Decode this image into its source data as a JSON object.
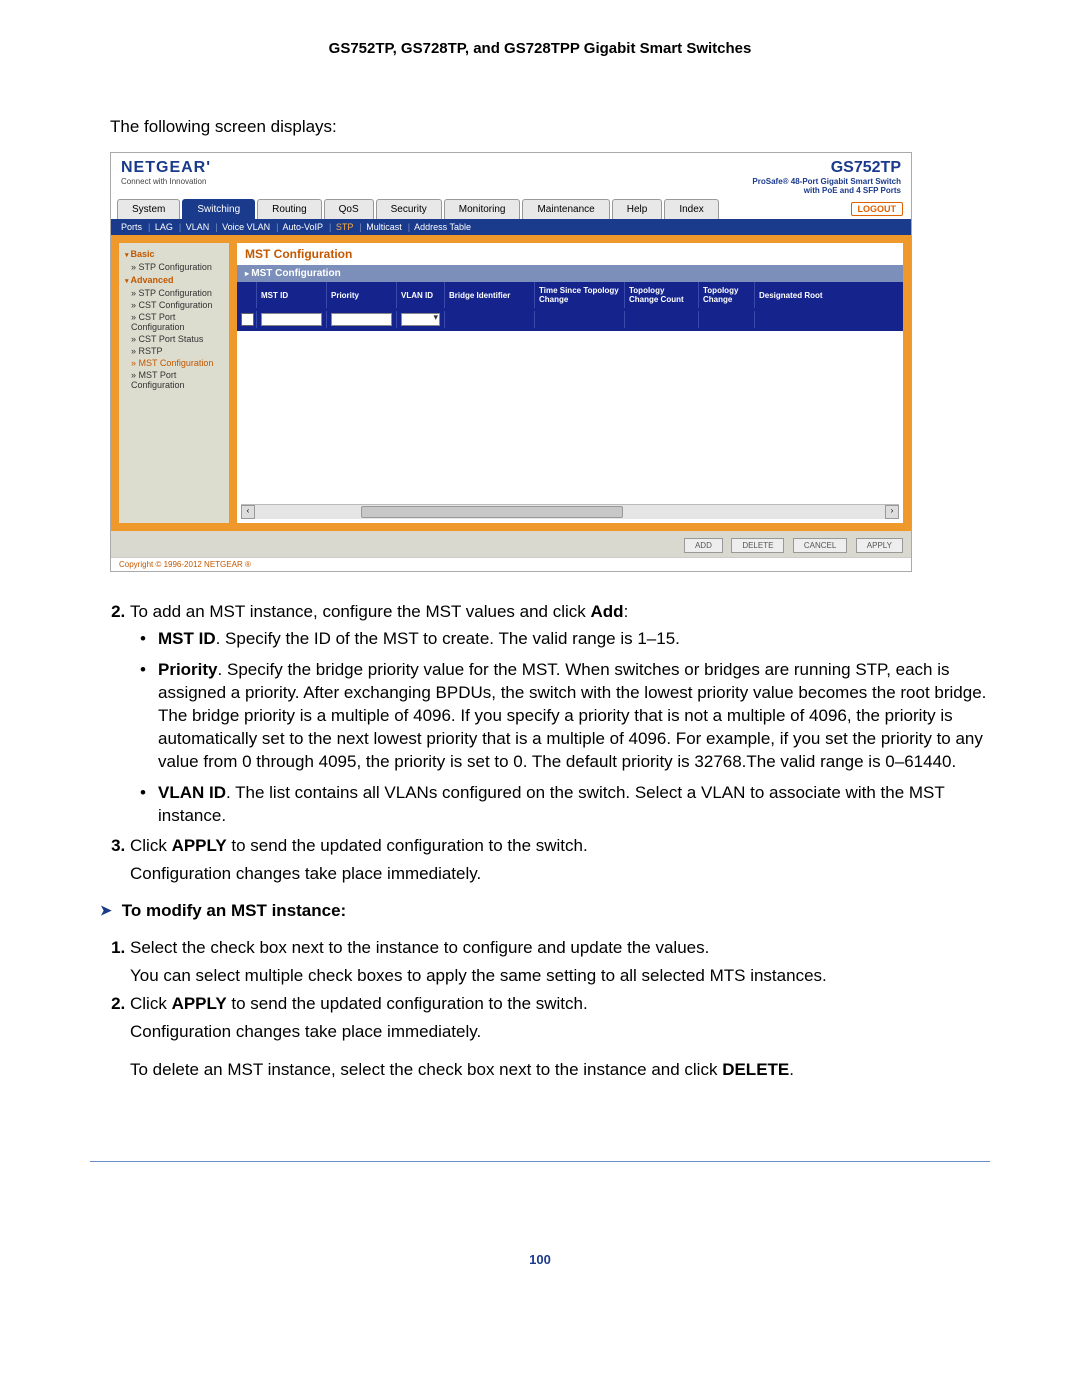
{
  "doc_header": "GS752TP, GS728TP, and GS728TPP Gigabit Smart Switches",
  "intro": "The following screen displays:",
  "screenshot": {
    "brand": "NETGEAR",
    "brand_sub": "Connect with Innovation",
    "model": "GS752TP",
    "model_sub1": "ProSafe® 48-Port Gigabit Smart Switch",
    "model_sub2": "with PoE and 4 SFP Ports",
    "logout": "LOGOUT",
    "main_tabs": [
      "System",
      "Switching",
      "Routing",
      "QoS",
      "Security",
      "Monitoring",
      "Maintenance",
      "Help",
      "Index"
    ],
    "active_main_tab": "Switching",
    "sub_tabs": [
      "Ports",
      "LAG",
      "VLAN",
      "Voice VLAN",
      "Auto-VoIP",
      "STP",
      "Multicast",
      "Address Table"
    ],
    "active_sub_tab": "STP",
    "sidebar": {
      "basic_head": "Basic",
      "basic_items": [
        "STP Configuration"
      ],
      "adv_head": "Advanced",
      "adv_items": [
        "STP Configuration",
        "CST Configuration",
        "CST Port Configuration",
        "CST Port Status",
        "RSTP",
        "MST Configuration",
        "MST Port Configuration"
      ],
      "adv_highlight": "MST Configuration"
    },
    "panel_title": "MST Configuration",
    "panel_bar": "MST Configuration",
    "columns": [
      "",
      "MST ID",
      "Priority",
      "VLAN ID",
      "Bridge Identifier",
      "Time Since Topology Change",
      "Topology Change Count",
      "Topology Change",
      "Designated Root"
    ],
    "action_buttons": [
      "ADD",
      "DELETE",
      "CANCEL",
      "APPLY"
    ],
    "copyright": "Copyright © 1996-2012 NETGEAR ®"
  },
  "step2": {
    "num": "2.",
    "text_a": "To add an MST instance, configure the MST values and click ",
    "text_b": "Add",
    "text_c": ":",
    "bullets": [
      {
        "b": "MST ID",
        "t": ". Specify the ID of the MST to create. The valid range is 1–15."
      },
      {
        "b": "Priority",
        "t": ". Specify the bridge priority value for the MST. When switches or bridges are running STP, each is assigned a priority. After exchanging BPDUs, the switch with the lowest priority value becomes the root bridge. The bridge priority is a multiple of 4096. If you specify a priority that is not a multiple of 4096, the priority is automatically set to the next lowest priority that is a multiple of 4096. For example, if you set the priority to any value from 0 through 4095, the priority is set to 0. The default priority is 32768.The valid range is 0–61440."
      },
      {
        "b": "VLAN ID",
        "t": ". The list contains all VLANs configured on the switch. Select a VLAN to associate with the MST instance."
      }
    ]
  },
  "step3": {
    "num": "3.",
    "text_a": "Click ",
    "text_b": "APPLY",
    "text_c": " to send the updated configuration to the switch.",
    "after": "Configuration changes take place immediately."
  },
  "task2_title": "To modify an MST instance:",
  "t2_step1": {
    "num": "1.",
    "text": "Select the check box next to the instance to configure and update the values.",
    "after": "You can select multiple check boxes to apply the same setting to all selected MTS instances."
  },
  "t2_step2": {
    "num": "2.",
    "text_a": "Click ",
    "text_b": "APPLY",
    "text_c": " to send the updated configuration to the switch.",
    "after": "Configuration changes take place immediately."
  },
  "delete_line_a": "To delete an MST instance, select the check box next to the instance and click ",
  "delete_line_b": "DELETE",
  "delete_line_c": ".",
  "page_number": "100"
}
